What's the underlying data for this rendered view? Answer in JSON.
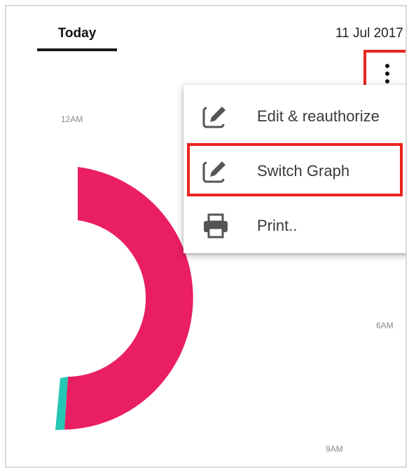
{
  "header": {
    "tab_today": "Today",
    "date": "11 Jul 2017"
  },
  "overflow_menu": {
    "icon": "more-vert-icon",
    "items": [
      {
        "label": "Edit & reauthorize",
        "icon": "edit-icon"
      },
      {
        "label": "Switch Graph",
        "icon": "edit-icon"
      },
      {
        "label": "Print..",
        "icon": "print-icon"
      }
    ]
  },
  "clock_labels": {
    "top": "12AM",
    "right": "6AM",
    "bottom": "9AM"
  },
  "colors": {
    "primary_segment": "#E91E63",
    "secondary_segment": "#26C6B5",
    "highlight_box": "#E8261D"
  }
}
